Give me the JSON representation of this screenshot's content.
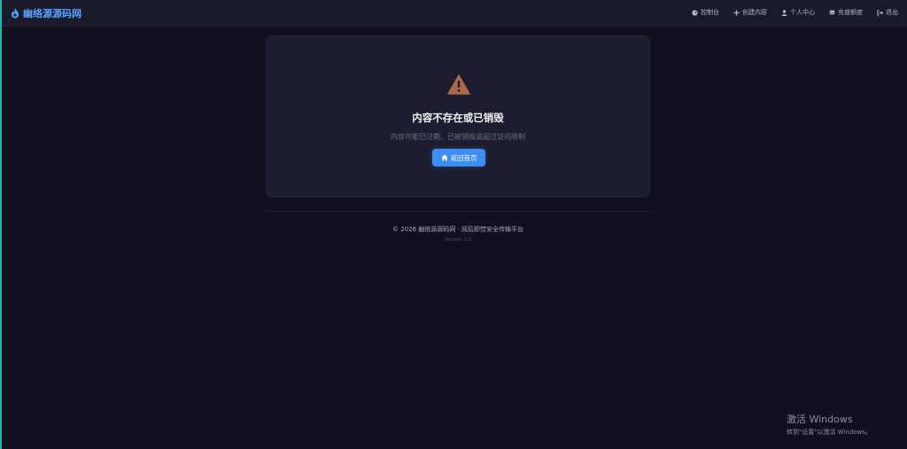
{
  "header": {
    "brand": "幽络源源码网",
    "nav": [
      {
        "label": "控制台",
        "icon": "dashboard-icon"
      },
      {
        "label": "创建内容",
        "icon": "plus-icon"
      },
      {
        "label": "个人中心",
        "icon": "user-icon"
      },
      {
        "label": "充值额度",
        "icon": "coins-icon"
      },
      {
        "label": "退出",
        "icon": "logout-icon"
      }
    ]
  },
  "notice": {
    "icon": "warning-icon",
    "title": "内容不存在或已销毁",
    "subtitle": "内容可能已过期、已被销毁或超过访问限制",
    "button_label": "返回首页",
    "button_icon": "home-icon"
  },
  "footer": {
    "copyright": "© 2026 幽络源源码网 · 阅后即焚安全传输平台",
    "version": "Version 2.5"
  },
  "os_watermark": {
    "title": "激活 Windows",
    "subtitle": "转到\"设置\"以激活 Windows。"
  },
  "colors": {
    "background": "#12101f",
    "header": "#1b1a2c",
    "card": "#1e1c2f",
    "accent": "#3d8ef2",
    "brand": "#5aa2ff",
    "warning": "#a86a48"
  }
}
